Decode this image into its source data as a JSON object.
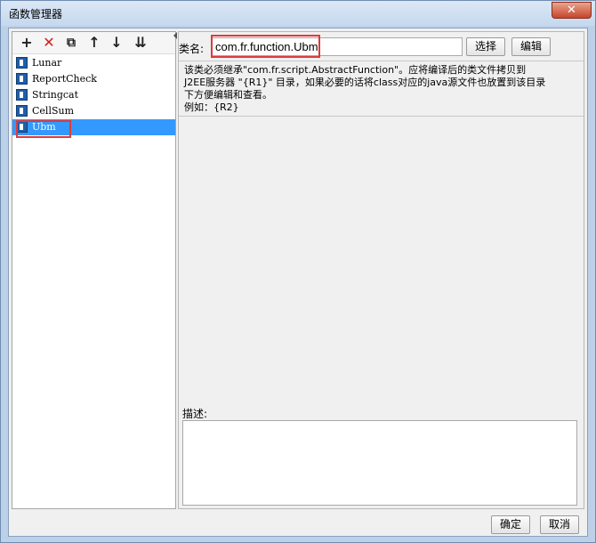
{
  "window": {
    "title": "函数管理器",
    "close_symbol": "✕"
  },
  "toolbar": {
    "add_icon": "+",
    "delete_icon": "✕",
    "copy_icon": "⧉",
    "up_icon": "↑",
    "down_icon": "↓",
    "sort_icon": "⇊"
  },
  "functions": [
    {
      "label": "Lunar"
    },
    {
      "label": "ReportCheck"
    },
    {
      "label": "Stringcat"
    },
    {
      "label": "CellSum"
    },
    {
      "label": "Ubm"
    }
  ],
  "selected_function": "Ubm",
  "class_field": {
    "label": "类名:",
    "value": "com.fr.function.Ubm",
    "select_label": "选择",
    "edit_label": "编辑"
  },
  "help_text": {
    "line1": "该类必须继承\"com.fr.script.AbstractFunction\"。应将编译后的类文件拷贝到",
    "line2": "J2EE服务器 \"{R1}\" 目录，如果必要的话将class对应的java源文件也放置到该目录",
    "line3": "下方便编辑和查看。",
    "line4": "例如：{R2}"
  },
  "description": {
    "label": "描述:",
    "value": ""
  },
  "footer": {
    "ok_label": "确定",
    "cancel_label": "取消"
  },
  "colors": {
    "highlight": "#e03a3a",
    "selection": "#3399ff"
  }
}
